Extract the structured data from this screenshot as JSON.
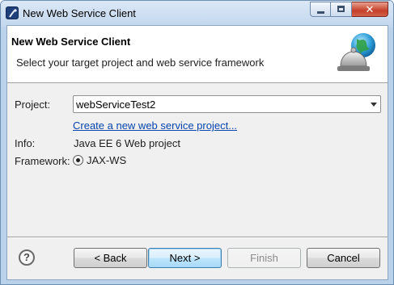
{
  "window": {
    "title": "New Web Service Client"
  },
  "header": {
    "title": "New Web Service Client",
    "description": "Select your target project and web service framework",
    "graphic_icon": "web-service-globe-bell-icon"
  },
  "form": {
    "project_label": "Project:",
    "project_value": "webServiceTest2",
    "create_link": "Create a new web service project...",
    "info_label": "Info:",
    "info_value": "Java EE 6 Web project",
    "framework_label": "Framework:",
    "framework_option": "JAX-WS",
    "framework_selected": true
  },
  "buttons": {
    "help_icon": "question-mark-icon",
    "help_glyph": "?",
    "back": "< Back",
    "next": "Next >",
    "finish": "Finish",
    "cancel": "Cancel"
  },
  "colors": {
    "link": "#0645ad",
    "title_bar": "#c2d7ee",
    "close_button": "#c4402a"
  }
}
